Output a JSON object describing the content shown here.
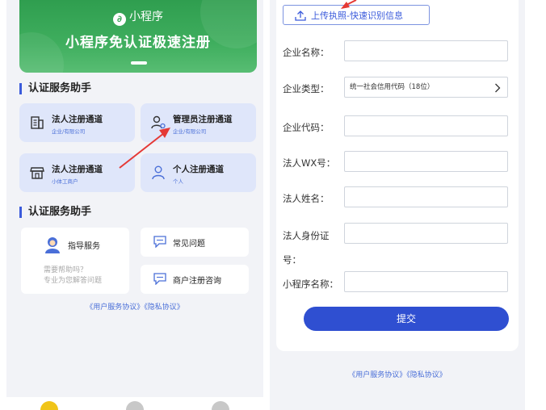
{
  "left": {
    "hero": {
      "mini_program": "小程序",
      "logo_glyph": "∂",
      "title": "小程序免认证极速注册"
    },
    "section1_title": "认证服务助手",
    "services": [
      {
        "name": "法人注册通道",
        "sub": "企业/有限公司",
        "icon": "building-icon"
      },
      {
        "name": "管理员注册通道",
        "sub": "企业/有限公司",
        "icon": "admin-user-icon"
      },
      {
        "name": "法人注册通道",
        "sub": "小体工商户",
        "icon": "shop-icon"
      },
      {
        "name": "个人注册通道",
        "sub": "个人",
        "icon": "person-icon"
      }
    ],
    "section2_title": "认证服务助手",
    "help": {
      "guide_label": "指导服务",
      "guide_text1": "需要帮助吗？",
      "guide_text2": "专业为您解答问题",
      "faq_label": "常见问题",
      "consult_label": "商户注册咨询"
    },
    "agreement": "《用户服务协议》《隐私协议》"
  },
  "right": {
    "upload_label": "上传执照-快速识别信息",
    "fields": {
      "company_name": "企业名称：",
      "company_type": "企业类型：",
      "company_type_value": "统一社会信用代码（18位）",
      "company_code": "企业代码：",
      "legal_wx": "法人WX号：",
      "legal_name": "法人姓名：",
      "legal_id_line1": "法人身份证",
      "legal_id_line2": "号：",
      "mp_name": "小程序名称："
    },
    "submit_label": "提交",
    "agreement": "《用户服务协议》《隐私协议》"
  },
  "colors": {
    "accent": "#2f4fd1",
    "hero_green": "#3fae5e",
    "card_blue": "#dfe6fa",
    "arrow_red": "#e53935"
  }
}
